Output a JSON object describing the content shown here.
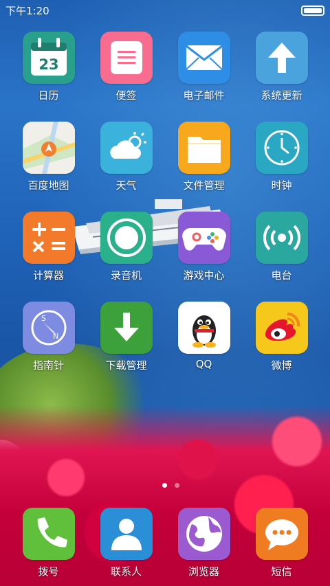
{
  "status": {
    "time": "下午1:20",
    "battery_level": 1.0
  },
  "apps": [
    {
      "label": "日历",
      "icon": "calendar-icon",
      "bg": "#29a08c",
      "extra": "23"
    },
    {
      "label": "便签",
      "icon": "notes-icon",
      "bg": "#f76c8f"
    },
    {
      "label": "电子邮件",
      "icon": "mail-icon",
      "bg": "#2e8ee6"
    },
    {
      "label": "系统更新",
      "icon": "update-arrow-icon",
      "bg": "#4aa3dc"
    },
    {
      "label": "百度地图",
      "icon": "map-icon",
      "bg": "#f2f2f2"
    },
    {
      "label": "天气",
      "icon": "weather-icon",
      "bg": "#3bb2dc"
    },
    {
      "label": "文件管理",
      "icon": "folder-icon",
      "bg": "#f7a81d"
    },
    {
      "label": "时钟",
      "icon": "clock-icon",
      "bg": "#2aa7c3"
    },
    {
      "label": "计算器",
      "icon": "calculator-icon",
      "bg": "#f27a2a"
    },
    {
      "label": "录音机",
      "icon": "recorder-icon",
      "bg": "#2ab08a"
    },
    {
      "label": "游戏中心",
      "icon": "gamepad-icon",
      "bg": "#8a5ad6"
    },
    {
      "label": "电台",
      "icon": "radio-icon",
      "bg": "#2aa8a0"
    },
    {
      "label": "指南针",
      "icon": "compass-icon",
      "bg": "#7d8be0"
    },
    {
      "label": "下载管理",
      "icon": "download-icon",
      "bg": "#3da13b"
    },
    {
      "label": "QQ",
      "icon": "qq-penguin-icon",
      "bg": "#ffffff"
    },
    {
      "label": "微博",
      "icon": "weibo-icon",
      "bg": "#f7c81c"
    }
  ],
  "dock": [
    {
      "label": "拨号",
      "icon": "phone-icon",
      "bg": "#61c03b"
    },
    {
      "label": "联系人",
      "icon": "contacts-icon",
      "bg": "#2a8fd6"
    },
    {
      "label": "浏览器",
      "icon": "browser-globe-icon",
      "bg": "#9b5ad0"
    },
    {
      "label": "短信",
      "icon": "sms-icon",
      "bg": "#f07c22"
    }
  ],
  "pager": {
    "pages": 2,
    "current": 1
  }
}
